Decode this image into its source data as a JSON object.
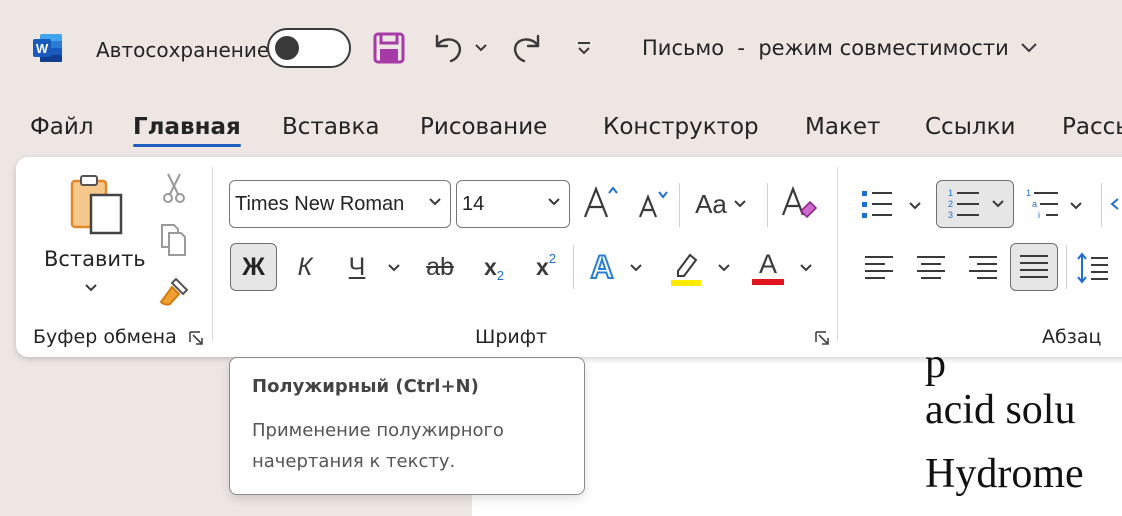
{
  "titlebar": {
    "autosave_label": "Автосохранение",
    "document_title": "Письмо  -  режим совместимости",
    "app_icon": "W"
  },
  "tabs": [
    {
      "label": "Файл",
      "active": false
    },
    {
      "label": "Главная",
      "active": true
    },
    {
      "label": "Вставка",
      "active": false
    },
    {
      "label": "Рисование",
      "active": false
    },
    {
      "label": "Конструктор",
      "active": false
    },
    {
      "label": "Макет",
      "active": false
    },
    {
      "label": "Ссылки",
      "active": false
    },
    {
      "label": "Рассь",
      "active": false
    }
  ],
  "clipboard": {
    "paste_label": "Вставить",
    "group_label": "Буфер обмена"
  },
  "font": {
    "font_name": "Times New Roman",
    "font_size": "14",
    "case_label": "Aa",
    "bold_label": "Ж",
    "italic_label": "К",
    "underline_label": "Ч",
    "strike_label": "ab",
    "subscript_label": "x",
    "subscript_mark": "2",
    "superscript_label": "x",
    "superscript_mark": "2",
    "text_effects_label": "A",
    "font_color_label": "A",
    "group_label": "Шрифт"
  },
  "paragraph": {
    "group_label": "Абзац"
  },
  "tooltip": {
    "title": "Полужирный (Ctrl+N)",
    "body": "Применение полужирного начертания к тексту."
  },
  "document": {
    "line1": "acid solu",
    "line2": "Hydrome"
  },
  "colors": {
    "word_blue": "#185abd",
    "save_purple": "#a63aa6",
    "highlight_yellow": "#ffeb00",
    "font_red": "#e0141e",
    "tab_underline": "#1f5fbf",
    "text_effects_blue": "#2a7fd4"
  }
}
